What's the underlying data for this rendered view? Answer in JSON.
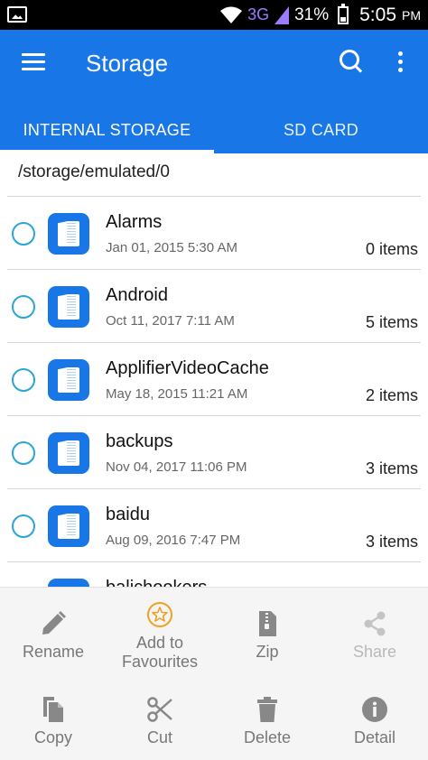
{
  "status_bar": {
    "network": "3G",
    "battery": "31%",
    "time": "5:05",
    "ampm": "PM"
  },
  "app_bar": {
    "title": "Storage",
    "icons": [
      "menu-icon",
      "search-icon",
      "more-vert-icon"
    ]
  },
  "tabs": [
    {
      "label": "INTERNAL STORAGE",
      "active": true
    },
    {
      "label": "SD CARD",
      "active": false
    }
  ],
  "path": "/storage/emulated/0",
  "files": [
    {
      "name": "Alarms",
      "date": "Jan 01, 2015 5:30 AM",
      "count": "0 items"
    },
    {
      "name": "Android",
      "date": "Oct 11, 2017 7:11 AM",
      "count": "5 items"
    },
    {
      "name": "ApplifierVideoCache",
      "date": "May 18, 2015 11:21 AM",
      "count": "2 items"
    },
    {
      "name": "backups",
      "date": "Nov 04, 2017 11:06 PM",
      "count": "3 items"
    },
    {
      "name": "baidu",
      "date": "Aug 09, 2016 7:47 PM",
      "count": "3 items"
    },
    {
      "name": "balichookers",
      "date": "",
      "count": ""
    }
  ],
  "actions": [
    {
      "label": "Rename",
      "icon": "pencil-icon",
      "enabled": true
    },
    {
      "label": "Add to Favourites",
      "label_line1": "Add to",
      "label_line2": "Favourites",
      "icon": "star-icon",
      "enabled": true
    },
    {
      "label": "Zip",
      "icon": "zip-icon",
      "enabled": true
    },
    {
      "label": "Share",
      "icon": "share-icon",
      "enabled": false
    },
    {
      "label": "Copy",
      "icon": "copy-icon",
      "enabled": true
    },
    {
      "label": "Cut",
      "icon": "scissors-icon",
      "enabled": true
    },
    {
      "label": "Delete",
      "icon": "trash-icon",
      "enabled": true
    },
    {
      "label": "Detail",
      "icon": "info-icon",
      "enabled": true
    }
  ],
  "colors": {
    "primary": "#1976e6",
    "radio": "#2aa4d9",
    "favourite": "#f0a020"
  }
}
